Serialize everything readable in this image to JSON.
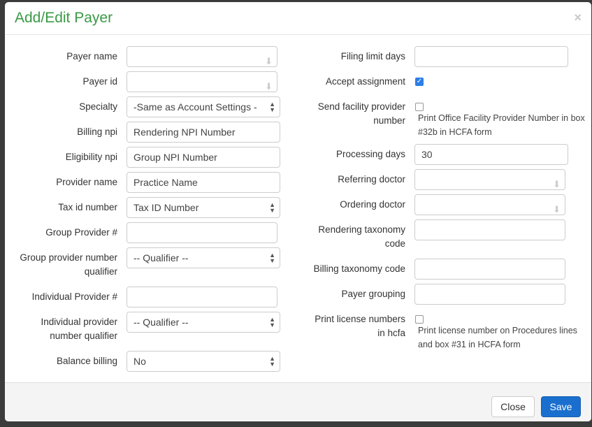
{
  "modal": {
    "title": "Add/Edit Payer",
    "close_icon": "×"
  },
  "left": [
    {
      "label": "Payer name",
      "value": "",
      "type": "autocomplete"
    },
    {
      "label": "Payer id",
      "value": "",
      "type": "autocomplete"
    },
    {
      "label": "Specialty",
      "value": "-Same as Account Settings -",
      "type": "select"
    },
    {
      "label": "Billing npi",
      "value": "Rendering NPI Number",
      "type": "text"
    },
    {
      "label": "Eligibility npi",
      "value": "Group NPI Number",
      "type": "text"
    },
    {
      "label": "Provider name",
      "value": "Practice Name",
      "type": "text"
    },
    {
      "label": "Tax id number",
      "value": "Tax ID Number",
      "type": "select"
    },
    {
      "label": "Group Provider #",
      "value": "",
      "type": "text"
    },
    {
      "label": "Group provider number qualifier",
      "value": "-- Qualifier --",
      "type": "select"
    },
    {
      "label": "Individual Provider #",
      "value": "",
      "type": "text"
    },
    {
      "label": "Individual provider number qualifier",
      "value": "-- Qualifier --",
      "type": "select"
    },
    {
      "label": "Balance billing",
      "value": "No",
      "type": "select"
    }
  ],
  "right": {
    "filing_limit_days": {
      "label": "Filing limit days",
      "value": ""
    },
    "accept_assignment": {
      "label": "Accept assignment",
      "checked": true
    },
    "send_facility": {
      "label": "Send facility provider number",
      "checked": false,
      "desc": "Print Office Facility Provider Number in box #32b in HCFA form"
    },
    "processing_days": {
      "label": "Processing days",
      "value": "30"
    },
    "referring_doctor": {
      "label": "Referring doctor",
      "value": ""
    },
    "ordering_doctor": {
      "label": "Ordering doctor",
      "value": ""
    },
    "rendering_taxonomy": {
      "label": "Rendering taxonomy code",
      "value": ""
    },
    "billing_taxonomy": {
      "label": "Billing taxonomy code",
      "value": ""
    },
    "payer_grouping": {
      "label": "Payer grouping",
      "value": ""
    },
    "print_license": {
      "label": "Print license numbers in hcfa",
      "checked": false,
      "desc": "Print license number on Procedures lines and box #31 in HCFA form"
    }
  },
  "footer": {
    "close_label": "Close",
    "save_label": "Save"
  },
  "colors": {
    "title": "#3a9a45",
    "save": "#1a6fce",
    "checkbox": "#2d7ee8"
  }
}
